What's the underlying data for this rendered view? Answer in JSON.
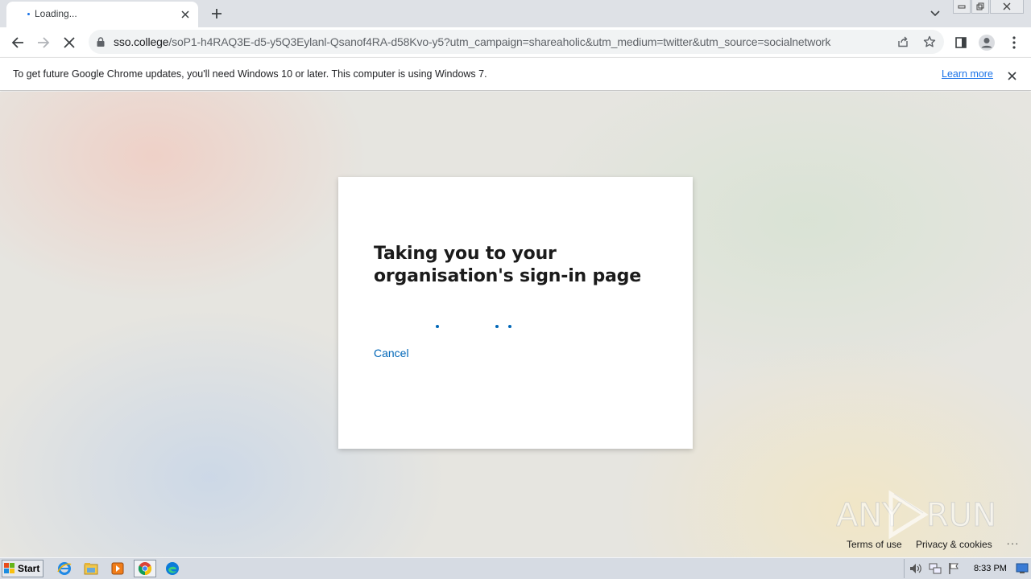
{
  "browser": {
    "tab": {
      "title": "Loading..."
    },
    "address": {
      "host": "sso.college",
      "path": "/soP1-h4RAQ3E-d5-y5Q3Eylanl-Qsanof4RA-d58Kvo-y5?utm_campaign=shareaholic&utm_medium=twitter&utm_source=socialnetwork"
    },
    "infobar": {
      "message": "To get future Google Chrome updates, you'll need Windows 10 or later. This computer is using Windows 7.",
      "link": "Learn more"
    }
  },
  "page": {
    "heading_line1": "Taking you to your",
    "heading_line2": "organisation's sign-in page",
    "cancel_label": "Cancel",
    "footer": {
      "terms": "Terms of use",
      "privacy": "Privacy & cookies",
      "more": "..."
    },
    "watermark": "ANY RUN"
  },
  "taskbar": {
    "start_label": "Start",
    "clock": "8:33 PM"
  },
  "colors": {
    "link_blue": "#0067b8",
    "chrome_blue": "#1a73e8"
  }
}
